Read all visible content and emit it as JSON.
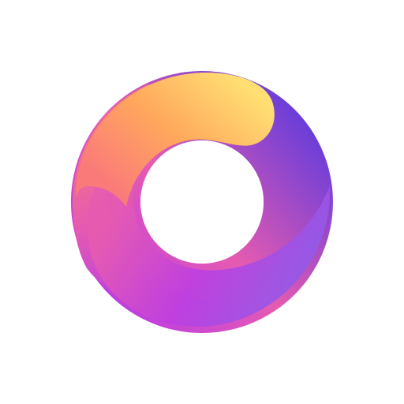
{
  "logo": {
    "icon_name": "swirl-ring-logo-icon",
    "colors": {
      "background": "#ffffff",
      "yellow": "#FFDE73",
      "orange": "#FFA85C",
      "coral": "#FA7A7A",
      "pink": "#E65BB0",
      "magenta": "#BF3FE0",
      "purple": "#7A44E6",
      "deep_purple": "#6A3ED9",
      "violet": "#8F5CE8"
    }
  }
}
